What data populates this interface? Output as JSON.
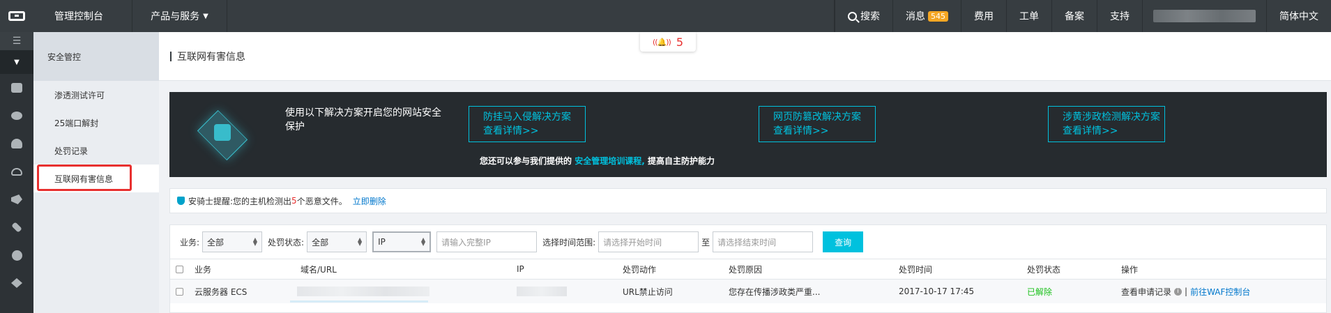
{
  "topbar": {
    "console": "管理控制台",
    "products": "产品与服务",
    "search": "搜索",
    "messages": "消息",
    "messages_count": "545",
    "billing": "费用",
    "tickets": "工单",
    "icp": "备案",
    "support": "支持",
    "language": "简体中文"
  },
  "subnav": {
    "header": "安全管控",
    "items": [
      {
        "label": "渗透测试许可"
      },
      {
        "label": "25端口解封"
      },
      {
        "label": "处罚记录"
      },
      {
        "label": "互联网有害信息"
      }
    ]
  },
  "page": {
    "title": "互联网有害信息",
    "notify_count": "5"
  },
  "banner": {
    "lead": "使用以下解决方案开启您的网站安全保护",
    "solutions": [
      {
        "name": "防挂马入侵解决方案",
        "detail": "查看详情>>"
      },
      {
        "name": "网页防篡改解决方案",
        "detail": "查看详情>>"
      },
      {
        "name": "涉黄涉政检测解决方案",
        "detail": "查看详情>>"
      }
    ],
    "tip_prefix": "您还可以参与我们提供的",
    "tip_link": "安全管理培训课程,",
    "tip_suffix": "提高自主防护能力"
  },
  "alert": {
    "prefix": "安骑士提醒:您的主机检测出",
    "count": "5",
    "suffix": "个恶意文件。",
    "action": "立即删除"
  },
  "filters": {
    "business_label": "业务:",
    "business_value": "全部",
    "status_label": "处罚状态:",
    "status_value": "全部",
    "type_value": "IP",
    "ip_placeholder": "请输入完整IP",
    "range_label": "选择时间范围:",
    "start_placeholder": "请选择开始时间",
    "to": "至",
    "end_placeholder": "请选择结束时间",
    "query": "查询"
  },
  "table": {
    "columns": [
      "业务",
      "域名/URL",
      "IP",
      "处罚动作",
      "处罚原因",
      "处罚时间",
      "处罚状态",
      "操作"
    ],
    "rows": [
      {
        "business": "云服务器 ECS",
        "action": "URL禁止访问",
        "reason": "您存在传播涉政类严重...",
        "time": "2017-10-17 17:45",
        "status": "已解除",
        "op_view": "查看申请记录",
        "op_sep": "|",
        "op_waf": "前往WAF控制台"
      }
    ]
  },
  "colors": {
    "topbar_bg": "#373d41",
    "accent": "#00c1de",
    "badge": "#f5a623",
    "danger": "#e8302f",
    "success": "#1dc11d"
  }
}
